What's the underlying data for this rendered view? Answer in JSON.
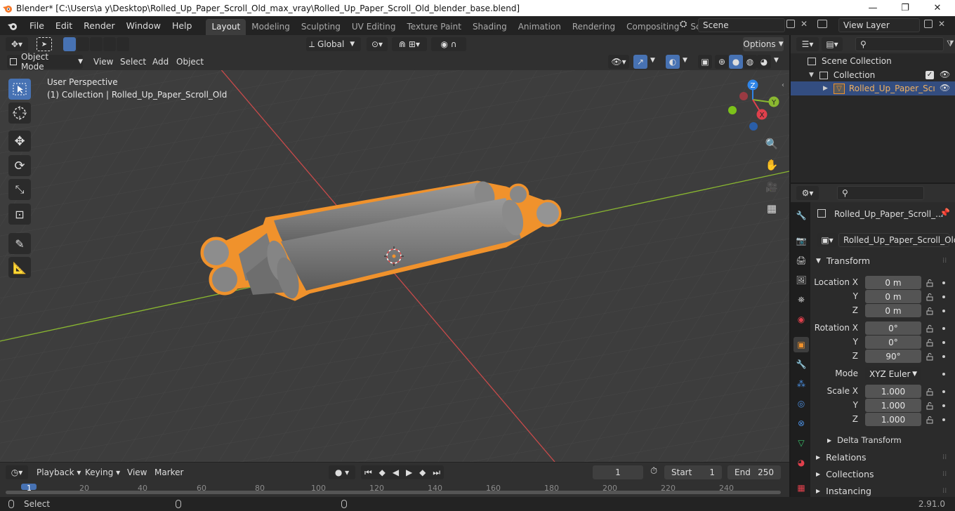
{
  "window": {
    "title": "Blender* [C:\\Users\\a y\\Desktop\\Rolled_Up_Paper_Scroll_Old_max_vray\\Rolled_Up_Paper_Scroll_Old_blender_base.blend]",
    "minimize": "—",
    "maximize": "❐",
    "close": "✕"
  },
  "menu": [
    "File",
    "Edit",
    "Render",
    "Window",
    "Help"
  ],
  "workspaces": [
    "Layout",
    "Modeling",
    "Sculpting",
    "UV Editing",
    "Texture Paint",
    "Shading",
    "Animation",
    "Rendering",
    "Compositing",
    "Scripting"
  ],
  "active_workspace": "Layout",
  "scene": {
    "name": "Scene",
    "view_layer": "View Layer",
    "add": "+"
  },
  "viewport_header": {
    "transform_orientation": "Global",
    "options": "Options",
    "mode": "Object Mode",
    "menus": [
      "View",
      "Select",
      "Add",
      "Object"
    ]
  },
  "viewport": {
    "perspective": "User Perspective",
    "collection_info": "(1) Collection | Rolled_Up_Paper_Scroll_Old",
    "gizmo_axes": {
      "x": "X",
      "y": "Y",
      "z": "Z"
    },
    "colors": {
      "x_axis": "#e0404c",
      "y_axis": "#8ab830",
      "z_axis": "#2f85e8",
      "selection": "#f0922c",
      "active_tool": "#4772b3"
    }
  },
  "timeline": {
    "menus": [
      "Playback",
      "Keying",
      "View",
      "Marker"
    ],
    "current_frame": "1",
    "start_label": "Start",
    "start": "1",
    "end_label": "End",
    "end": "250",
    "ruler_ticks": [
      "1",
      "20",
      "40",
      "60",
      "80",
      "100",
      "120",
      "140",
      "160",
      "180",
      "200",
      "220",
      "240"
    ]
  },
  "status": {
    "select": "Select",
    "version": "2.91.0"
  },
  "outliner": {
    "root": "Scene Collection",
    "collection": "Collection",
    "object": "Rolled_Up_Paper_Scı"
  },
  "properties": {
    "object_name_header": "Rolled_Up_Paper_Scroll_...",
    "object_name": "Rolled_Up_Paper_Scroll_Old",
    "transform_title": "Transform",
    "location_label": "Location X",
    "rotation_label": "Rotation X",
    "scale_label": "Scale X",
    "y_label": "Y",
    "z_label": "Z",
    "location": [
      "0 m",
      "0 m",
      "0 m"
    ],
    "rotation": [
      "0°",
      "0°",
      "90°"
    ],
    "mode_label": "Mode",
    "rotation_mode": "XYZ Euler",
    "scale": [
      "1.000",
      "1.000",
      "1.000"
    ],
    "delta_transform": "Delta Transform",
    "sections": [
      "Relations",
      "Collections",
      "Instancing"
    ]
  }
}
